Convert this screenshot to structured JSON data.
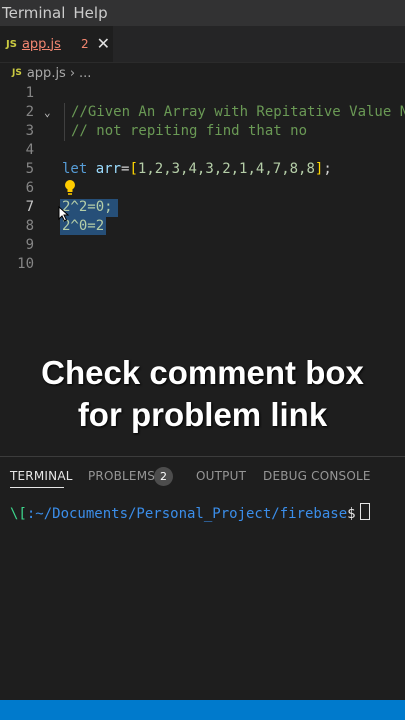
{
  "menu": {
    "items": [
      "Terminal",
      "Help"
    ]
  },
  "tab": {
    "icon_text": "JS",
    "filename": "app.js",
    "problem_count": "2",
    "close_glyph": "✕"
  },
  "breadcrumb": {
    "icon_text": "JS",
    "file": "app.js",
    "separator": "›",
    "more": "..."
  },
  "editor": {
    "line_numbers": [
      "1",
      "2",
      "3",
      "4",
      "5",
      "6",
      "7",
      "8",
      "9",
      "10"
    ],
    "lines": {
      "l2": "//Given An Array with Repitative Value N",
      "l3": "// not repiting find that no",
      "l5_kw": "let",
      "l5_var": "arr",
      "l5_eq": "=",
      "l5_open": "[",
      "l5_nums": "1,2,3,4,3,2,1,4,7,8,8",
      "l5_close": "]",
      "l5_end": ";",
      "l7": "2^2=0;",
      "l8": "2^0=2"
    }
  },
  "caption": {
    "line1": "Check comment box",
    "line2": "for problem link"
  },
  "panel": {
    "tabs": [
      "TERMINAL",
      "PROBLEMS",
      "OUTPUT",
      "DEBUG CONSOLE"
    ],
    "problems_badge": "2",
    "terminal": {
      "prefix": "\\[",
      "path": ":~/Documents/Personal_Project/firebase",
      "prompt": "$"
    }
  },
  "colors": {
    "status_bar": "#007acc",
    "selection": "#264f78",
    "comment": "#6a9955",
    "keyword": "#569cd6"
  }
}
